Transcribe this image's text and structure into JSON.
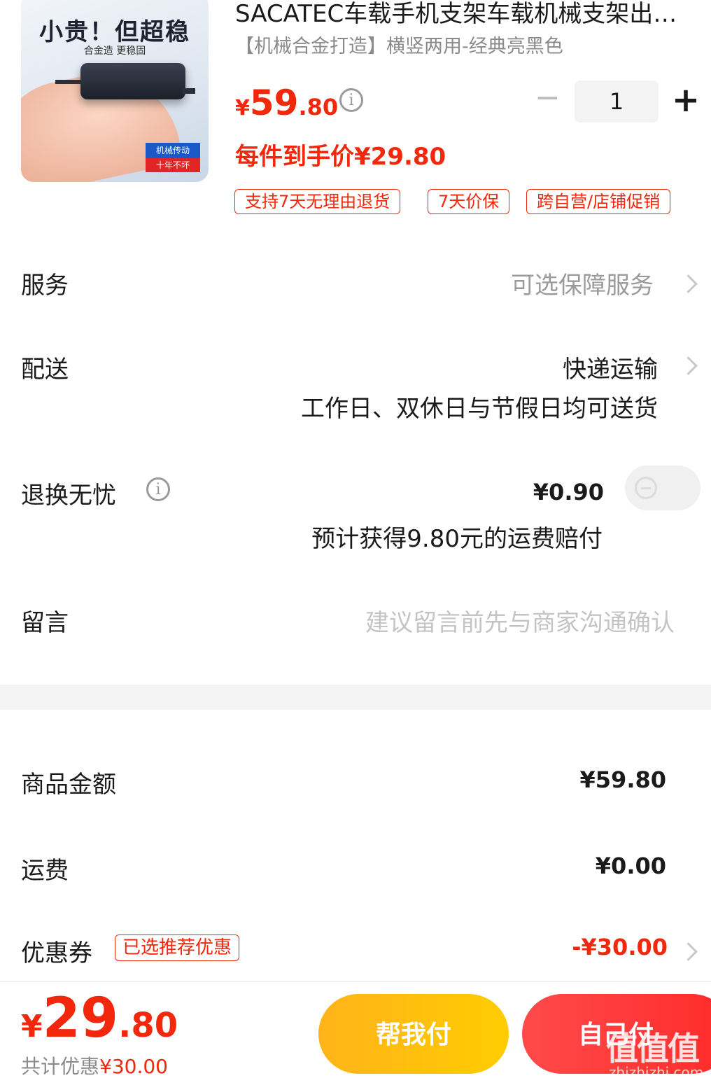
{
  "product": {
    "image_slogan": "小贵！但超稳",
    "image_sub": "合金造 更稳固",
    "image_badge1": "机械传动",
    "image_badge2": "十年不坏",
    "title": "SACATEC车载手机支架车载机械支架出风口车载导航支架",
    "spec": "【机械合金打造】横竖两用-经典亮黑色",
    "price_currency": "¥",
    "price_int": "59",
    "price_dec": ".80",
    "quantity": "1",
    "final_price": "每件到手价¥29.80",
    "tags": [
      "支持7天无理由退货",
      "7天价保",
      "跨自营/店铺促销"
    ]
  },
  "rows": {
    "service": {
      "label": "服务",
      "value": "可选保障服务"
    },
    "delivery": {
      "label": "配送",
      "value": "快递运输",
      "note": "工作日、双休日与节假日均可送货"
    },
    "return": {
      "label": "退换无忧",
      "value": "¥0.90",
      "note": "预计获得9.80元的运费赔付",
      "enabled": false
    },
    "message": {
      "label": "留言",
      "placeholder": "建议留言前先与商家沟通确认"
    }
  },
  "summary": {
    "goods_label": "商品金额",
    "goods_value": "¥59.80",
    "shipping_label": "运费",
    "shipping_value": "¥0.00",
    "coupon_label": "优惠券",
    "coupon_tag": "已选推荐优惠",
    "coupon_value": "-¥30.00"
  },
  "footer": {
    "total_currency": "¥",
    "total_int": "29",
    "total_dec": ".80",
    "saved_label": "共计优惠",
    "saved_value": "¥30.00",
    "help_pay_label": "帮我付",
    "self_pay_label": "自己付"
  },
  "watermark": {
    "text": "值值值",
    "url": "zhizhizhi.com"
  },
  "colors": {
    "accent": "#f2270c",
    "help_btn": "#ffbf0f",
    "pay_btn": "#ff3333"
  }
}
